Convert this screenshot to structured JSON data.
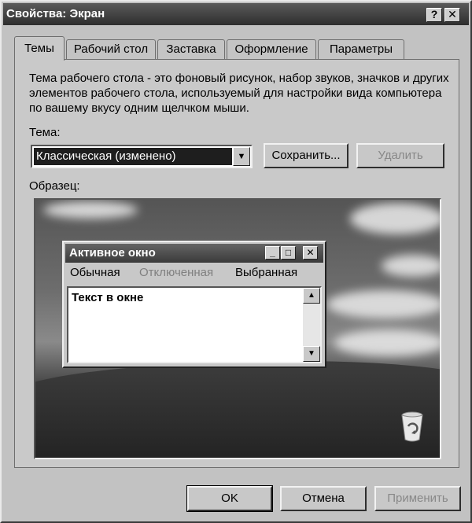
{
  "window": {
    "title": "Свойства: Экран",
    "help_label": "?",
    "close_label": "✕"
  },
  "tabs": [
    {
      "label": "Темы",
      "active": true
    },
    {
      "label": "Рабочий стол",
      "active": false
    },
    {
      "label": "Заставка",
      "active": false
    },
    {
      "label": "Оформление",
      "active": false
    },
    {
      "label": "Параметры",
      "active": false
    }
  ],
  "themes": {
    "description": "Тема рабочего стола - это фоновый рисунок, набор звуков, значков и других элементов рабочего стола, используемый для настройки вида компьютера по вашему вкусу одним щелчком мыши.",
    "theme_label": "Тема:",
    "theme_value": "Классическая (изменено)",
    "save_button": "Сохранить...",
    "delete_button": "Удалить",
    "sample_label": "Образец:"
  },
  "preview": {
    "window_title": "Активное окно",
    "menu_normal": "Обычная",
    "menu_disabled": "Отключенная",
    "menu_selected": "Выбранная",
    "text": "Текст в окне",
    "minimize_label": "_",
    "maximize_label": "□",
    "close_label": "✕"
  },
  "footer": {
    "ok": "OK",
    "cancel": "Отмена",
    "apply": "Применить"
  },
  "colors": {
    "titlebar": "#3a3a3a",
    "face": "#c8c8c8",
    "selection": "#1e1e1e",
    "disabled_text": "#888888"
  }
}
